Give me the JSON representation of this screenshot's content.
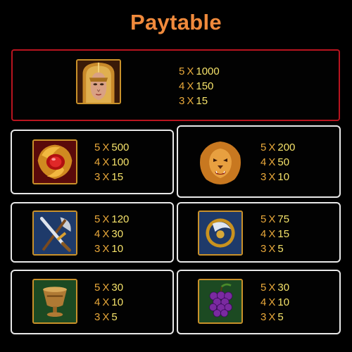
{
  "title": "Paytable",
  "symbols": [
    {
      "icon": "warrior-helmet-icon",
      "pays": [
        {
          "count": "5",
          "x": "X",
          "value": "1000"
        },
        {
          "count": "4",
          "x": "X",
          "value": "150"
        },
        {
          "count": "3",
          "x": "X",
          "value": "15"
        }
      ]
    },
    {
      "icon": "ruby-amulet-icon",
      "pays": [
        {
          "count": "5",
          "x": "X",
          "value": "500"
        },
        {
          "count": "4",
          "x": "X",
          "value": "100"
        },
        {
          "count": "3",
          "x": "X",
          "value": "15"
        }
      ]
    },
    {
      "icon": "lion-head-icon",
      "pays": [
        {
          "count": "5",
          "x": "X",
          "value": "200"
        },
        {
          "count": "4",
          "x": "X",
          "value": "50"
        },
        {
          "count": "3",
          "x": "X",
          "value": "10"
        }
      ]
    },
    {
      "icon": "sword-axe-icon",
      "pays": [
        {
          "count": "5",
          "x": "X",
          "value": "120"
        },
        {
          "count": "4",
          "x": "X",
          "value": "30"
        },
        {
          "count": "3",
          "x": "X",
          "value": "10"
        }
      ]
    },
    {
      "icon": "shield-icon",
      "pays": [
        {
          "count": "5",
          "x": "X",
          "value": "75"
        },
        {
          "count": "4",
          "x": "X",
          "value": "15"
        },
        {
          "count": "3",
          "x": "X",
          "value": "5"
        }
      ]
    },
    {
      "icon": "goblet-icon",
      "pays": [
        {
          "count": "5",
          "x": "X",
          "value": "30"
        },
        {
          "count": "4",
          "x": "X",
          "value": "10"
        },
        {
          "count": "3",
          "x": "X",
          "value": "5"
        }
      ]
    },
    {
      "icon": "grapes-icon",
      "pays": [
        {
          "count": "5",
          "x": "X",
          "value": "30"
        },
        {
          "count": "4",
          "x": "X",
          "value": "10"
        },
        {
          "count": "3",
          "x": "X",
          "value": "5"
        }
      ]
    }
  ],
  "colors": {
    "title": "#f08a3c",
    "top_border": "#b8141f",
    "card_border": "#e8e8e8",
    "pay_text": "#e9a83a",
    "pay_value": "#f5e26a"
  }
}
